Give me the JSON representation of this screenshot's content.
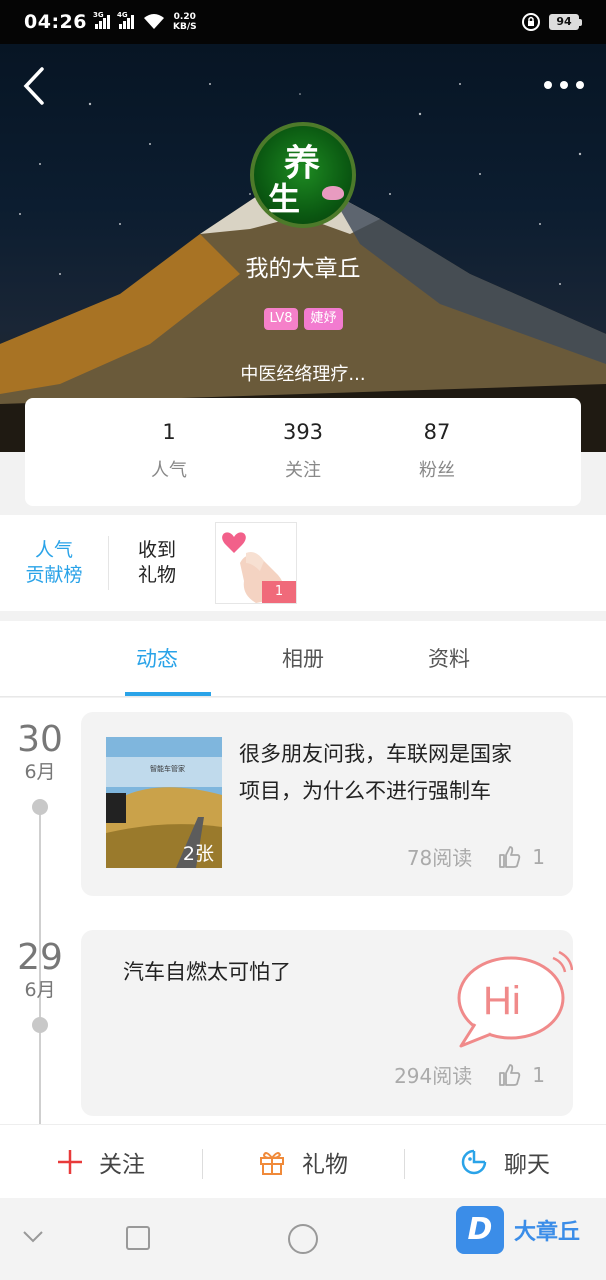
{
  "status_bar": {
    "time": "04:26",
    "network_1": "3G",
    "network_2": "4G",
    "speed_value": "0.20",
    "speed_unit": "KB/S",
    "battery": "94"
  },
  "profile": {
    "name": "我的大章丘",
    "level_badge": "LV8",
    "title_badge": "婕妤",
    "bio": "中医经络理疗..."
  },
  "stats": [
    {
      "value": "1",
      "label": "人气"
    },
    {
      "value": "393",
      "label": "关注"
    },
    {
      "value": "87",
      "label": "粉丝"
    }
  ],
  "gifts": {
    "rank_line1": "人气",
    "rank_line2": "贡献榜",
    "received_line1": "收到",
    "received_line2": "礼物",
    "gift_count": "1"
  },
  "tabs": [
    {
      "label": "动态",
      "active": true
    },
    {
      "label": "相册",
      "active": false
    },
    {
      "label": "资料",
      "active": false
    }
  ],
  "posts": [
    {
      "day": "30",
      "month": "6月",
      "text_line1": "很多朋友问我，车联网是国家",
      "text_line2": "项目，为什么不进行强制车",
      "image_count": "2张",
      "reads": "78阅读",
      "likes": "1"
    },
    {
      "day": "29",
      "month": "6月",
      "text": "汽车自燃太可怕了",
      "reads": "294阅读",
      "likes": "1",
      "sticker": "Hi"
    }
  ],
  "actions": {
    "follow": "关注",
    "gift": "礼物",
    "chat": "聊天"
  },
  "watermark": {
    "logo": "D",
    "text": "大章丘"
  },
  "colors": {
    "accent": "#2aa3e8",
    "badge_pink": "#f580c9",
    "follow_red": "#e83a3a",
    "gift_orange": "#f08a3a"
  }
}
